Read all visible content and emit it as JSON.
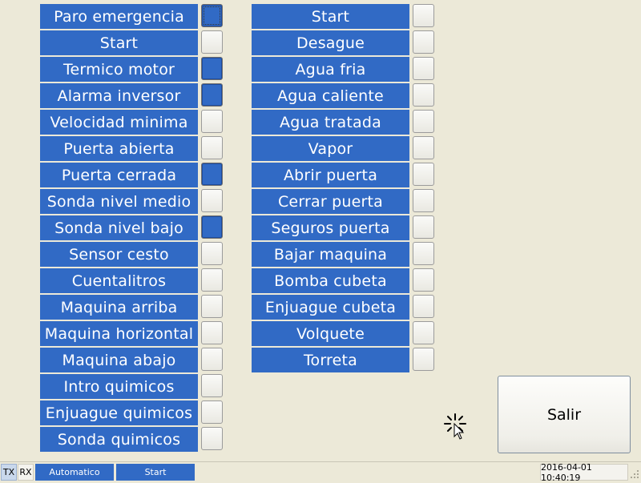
{
  "inputs": [
    {
      "label": "Paro emergencia",
      "on": true
    },
    {
      "label": "Start",
      "on": false
    },
    {
      "label": "Termico motor",
      "on": true
    },
    {
      "label": "Alarma inversor",
      "on": true
    },
    {
      "label": "Velocidad minima",
      "on": false
    },
    {
      "label": "Puerta abierta",
      "on": false
    },
    {
      "label": "Puerta cerrada",
      "on": true
    },
    {
      "label": "Sonda nivel medio",
      "on": false
    },
    {
      "label": "Sonda nivel bajo",
      "on": true
    },
    {
      "label": "Sensor cesto",
      "on": false
    },
    {
      "label": "Cuentalitros",
      "on": false
    },
    {
      "label": "Maquina arriba",
      "on": false
    },
    {
      "label": "Maquina horizontal",
      "on": false
    },
    {
      "label": "Maquina abajo",
      "on": false
    },
    {
      "label": "Intro quimicos",
      "on": false
    },
    {
      "label": "Enjuague quimicos",
      "on": false
    },
    {
      "label": "Sonda quimicos",
      "on": false
    }
  ],
  "outputs": [
    {
      "label": "Start",
      "on": false
    },
    {
      "label": "Desague",
      "on": false
    },
    {
      "label": "Agua fria",
      "on": false
    },
    {
      "label": "Agua caliente",
      "on": false
    },
    {
      "label": "Agua tratada",
      "on": false
    },
    {
      "label": "Vapor",
      "on": false
    },
    {
      "label": "Abrir puerta",
      "on": false
    },
    {
      "label": "Cerrar puerta",
      "on": false
    },
    {
      "label": "Seguros puerta",
      "on": false
    },
    {
      "label": "Bajar maquina",
      "on": false
    },
    {
      "label": "Bomba cubeta",
      "on": false
    },
    {
      "label": "Enjuague cubeta",
      "on": false
    },
    {
      "label": "Volquete",
      "on": false
    },
    {
      "label": "Torreta",
      "on": false
    }
  ],
  "salir_label": "Salir",
  "statusbar": {
    "tx": "TX",
    "rx": "RX",
    "mode": "Automatico",
    "state": "Start",
    "datetime": "2016-04-01 10:40:19"
  },
  "colors": {
    "accent": "#316AC5",
    "background": "#ECE9D8",
    "label_text": "#FFFFFF"
  }
}
